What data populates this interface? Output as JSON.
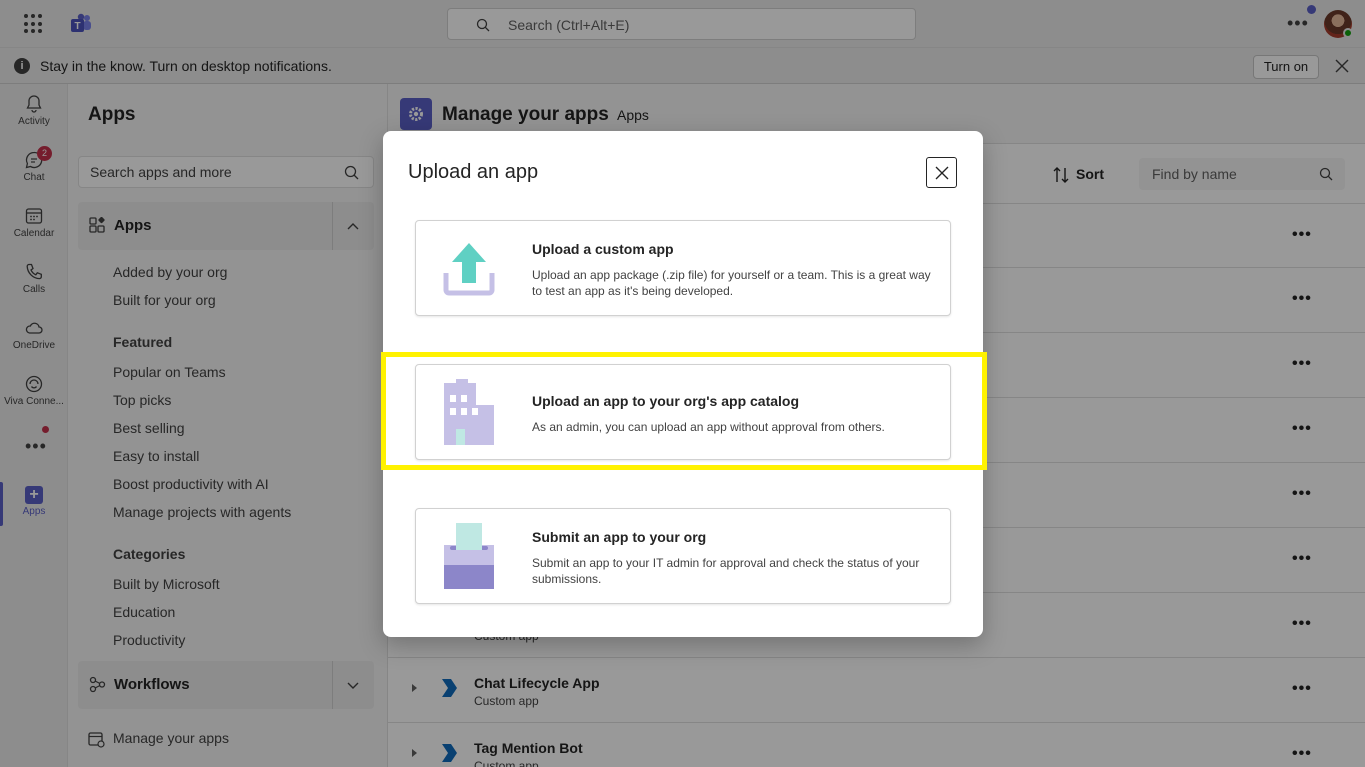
{
  "titlebar": {
    "search_placeholder": "Search (Ctrl+Alt+E)"
  },
  "notification": {
    "text": "Stay in the know. Turn on desktop notifications.",
    "turn_on_label": "Turn on"
  },
  "rail": {
    "items": [
      {
        "label": "Activity",
        "icon": "bell-icon"
      },
      {
        "label": "Chat",
        "icon": "chat-icon",
        "badge": "2"
      },
      {
        "label": "Calendar",
        "icon": "calendar-icon"
      },
      {
        "label": "Calls",
        "icon": "phone-icon"
      },
      {
        "label": "OneDrive",
        "icon": "cloud-icon"
      },
      {
        "label": "Viva Conne...",
        "icon": "viva-icon"
      },
      {
        "label": "Apps",
        "icon": "apps-icon"
      }
    ]
  },
  "apps_pane": {
    "title": "Apps",
    "search_placeholder": "Search apps and more",
    "apps_section": "Apps",
    "links_top": [
      "Added by your org",
      "Built for your org"
    ],
    "featured_heading": "Featured",
    "featured": [
      "Popular on Teams",
      "Top picks",
      "Best selling",
      "Easy to install",
      "Boost productivity with AI",
      "Manage projects with agents"
    ],
    "categories_heading": "Categories",
    "categories": [
      "Built by Microsoft",
      "Education",
      "Productivity"
    ],
    "workflows_section": "Workflows",
    "manage_link": "Manage your apps"
  },
  "main": {
    "title": "Manage your apps",
    "tab": "Apps",
    "sort_label": "Sort",
    "find_placeholder": "Find by name",
    "partial_row_subtitle": "Custom app",
    "rows": [
      {
        "name": "Chat Lifecycle App",
        "subtitle": "Custom app"
      },
      {
        "name": "Tag Mention Bot",
        "subtitle": "Custom app"
      }
    ]
  },
  "dialog": {
    "title": "Upload an app",
    "options": [
      {
        "title": "Upload a custom app",
        "description": "Upload an app package (.zip file) for yourself or a team. This is a great way to test an app as it's being developed."
      },
      {
        "title": "Upload an app to your org's app catalog",
        "description": "As an admin, you can upload an app without approval from others."
      },
      {
        "title": "Submit an app to your org",
        "description": "Submit an app to your IT admin for approval and check the status of your submissions."
      }
    ]
  },
  "colors": {
    "brand": "#5b5fc7",
    "highlight": "#fff200",
    "badge": "#c4314b"
  }
}
